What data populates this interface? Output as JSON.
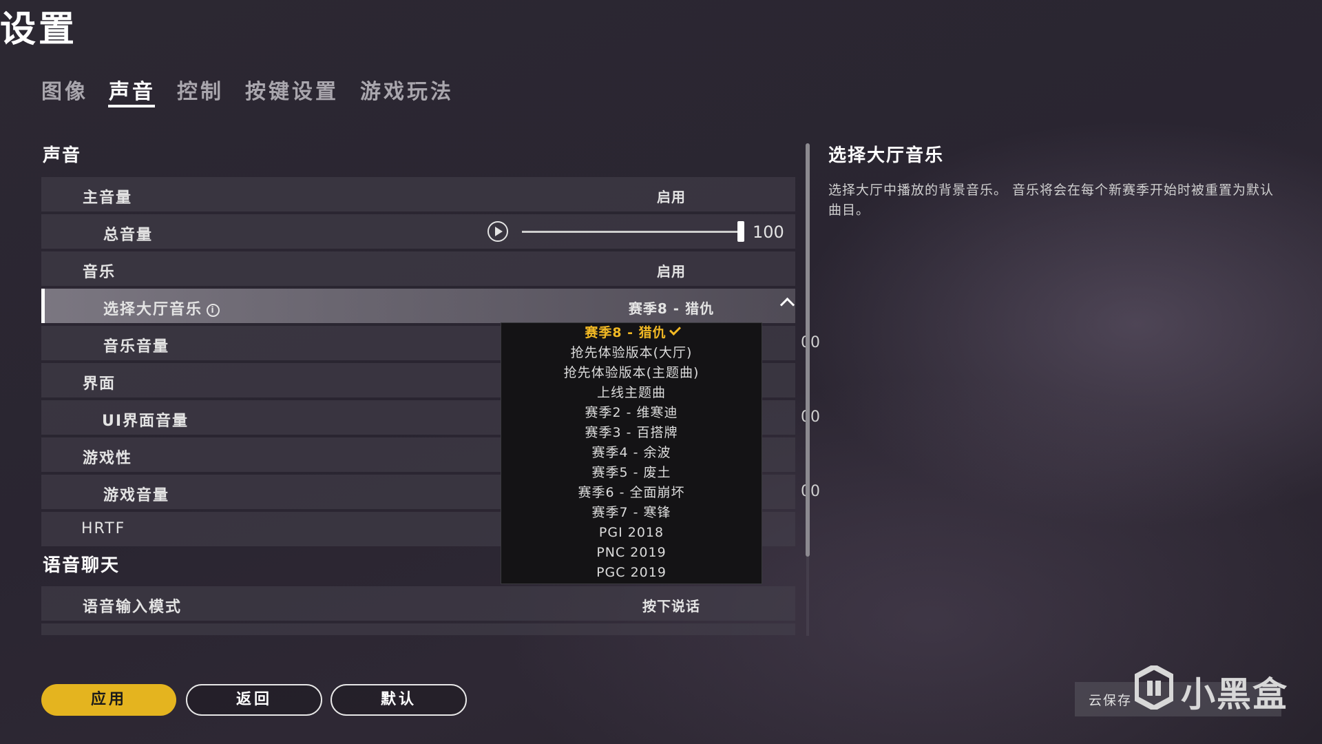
{
  "header": {
    "title": "设置",
    "tabs": [
      {
        "label": "图像",
        "active": false
      },
      {
        "label": "声音",
        "active": true
      },
      {
        "label": "控制",
        "active": false
      },
      {
        "label": "按键设置",
        "active": false
      },
      {
        "label": "游戏玩法",
        "active": false
      }
    ]
  },
  "sections": {
    "sound": {
      "title": "声音",
      "rows": {
        "master_volume": {
          "label": "主音量",
          "value": "启用"
        },
        "total_volume": {
          "label": "总音量",
          "value": "100",
          "level": 1.0
        },
        "music": {
          "label": "音乐",
          "value": "启用"
        },
        "lobby_music": {
          "label": "选择大厅音乐",
          "value": "赛季8 - 猎仇"
        },
        "music_volume": {
          "label": "音乐音量",
          "partial_value": "00"
        },
        "interface": {
          "label": "界面"
        },
        "ui_volume": {
          "label": "UI界面音量",
          "partial_value": "00"
        },
        "gameplay": {
          "label": "游戏性"
        },
        "game_volume": {
          "label": "游戏音量",
          "partial_value": "00"
        },
        "hrtf": {
          "label": "HRTF"
        }
      }
    },
    "voice_chat": {
      "title": "语音聊天",
      "rows": {
        "voice_input_mode": {
          "label": "语音输入模式",
          "value": "按下说话"
        }
      }
    }
  },
  "dropdown": {
    "options": [
      "赛季8 - 猎仇",
      "抢先体验版本(大厅)",
      "抢先体验版本(主题曲)",
      "上线主题曲",
      "赛季2 - 维寒迪",
      "赛季3 - 百搭牌",
      "赛季4 - 余波",
      "赛季5 - 废土",
      "赛季6 - 全面崩坏",
      "赛季7 - 寒锋",
      "PGI 2018",
      "PNC 2019",
      "PGC 2019"
    ],
    "selected_index": 0
  },
  "description": {
    "title": "选择大厅音乐",
    "text": "选择大厅中播放的背景音乐。 音乐将会在每个新赛季开始时被重置为默认曲目。"
  },
  "footer": {
    "apply_label": "应用",
    "back_label": "返回",
    "default_label": "默认"
  },
  "watermark": {
    "cloud_save": "云保存",
    "logo_text": "小黑盒"
  },
  "colors": {
    "accent": "#e4b41f",
    "selected_option": "#f2b924"
  }
}
